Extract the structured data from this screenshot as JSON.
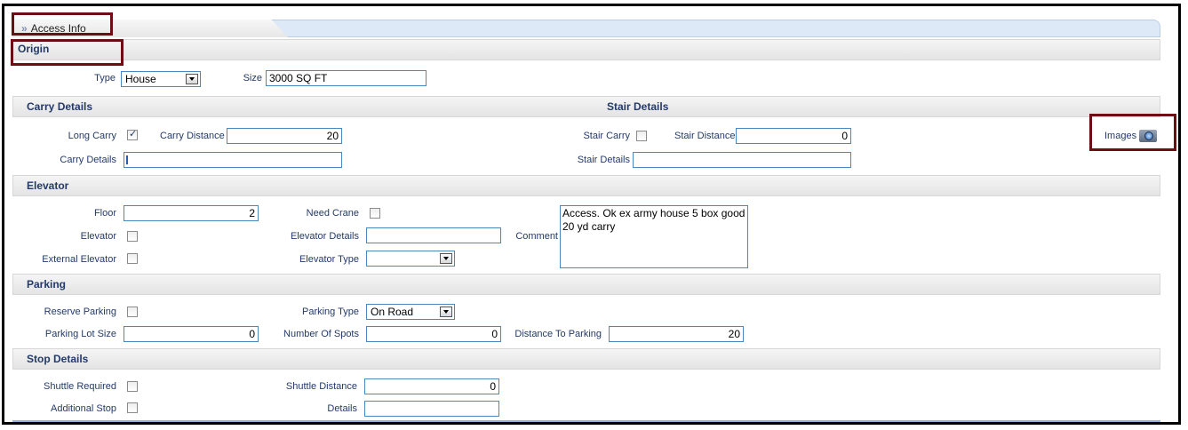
{
  "panel": {
    "title": "Access Info"
  },
  "origin": {
    "title": "Origin",
    "type_label": "Type",
    "type_value": "House",
    "size_label": "Size",
    "size_value": "3000 SQ FT"
  },
  "carry": {
    "title": "Carry Details",
    "long_carry_label": "Long Carry",
    "long_carry_checked": true,
    "carry_distance_label": "Carry Distance",
    "carry_distance_value": "20",
    "carry_details_label": "Carry Details",
    "carry_details_value": ""
  },
  "stair": {
    "title": "Stair Details",
    "stair_carry_label": "Stair Carry",
    "stair_carry_checked": false,
    "stair_distance_label": "Stair Distance",
    "stair_distance_value": "0",
    "stair_details_label": "Stair Details",
    "stair_details_value": ""
  },
  "images": {
    "label": "Images",
    "icon": "camera-icon"
  },
  "elevator": {
    "title": "Elevator",
    "floor_label": "Floor",
    "floor_value": "2",
    "need_crane_label": "Need Crane",
    "need_crane_checked": false,
    "elevator_label": "Elevator",
    "elevator_checked": false,
    "elevator_details_label": "Elevator Details",
    "elevator_details_value": "",
    "external_elevator_label": "External Elevator",
    "external_elevator_checked": false,
    "elevator_type_label": "Elevator Type",
    "elevator_type_value": "",
    "comment_label": "Comment",
    "comment_value": "Access. Ok ex army house 5 box good 20 yd carry"
  },
  "parking": {
    "title": "Parking",
    "reserve_parking_label": "Reserve Parking",
    "reserve_parking_checked": false,
    "parking_type_label": "Parking Type",
    "parking_type_value": "On Road",
    "parking_lot_size_label": "Parking Lot Size",
    "parking_lot_size_value": "0",
    "number_of_spots_label": "Number Of Spots",
    "number_of_spots_value": "0",
    "distance_to_parking_label": "Distance To Parking",
    "distance_to_parking_value": "20"
  },
  "stop": {
    "title": "Stop Details",
    "shuttle_required_label": "Shuttle Required",
    "shuttle_required_checked": false,
    "shuttle_distance_label": "Shuttle Distance",
    "shuttle_distance_value": "0",
    "additional_stop_label": "Additional Stop",
    "additional_stop_checked": false,
    "details_label": "Details",
    "details_value": ""
  },
  "colors": {
    "highlight_box": "#6b0f14",
    "input_border": "#4a88c2",
    "label": "#233a6a"
  }
}
